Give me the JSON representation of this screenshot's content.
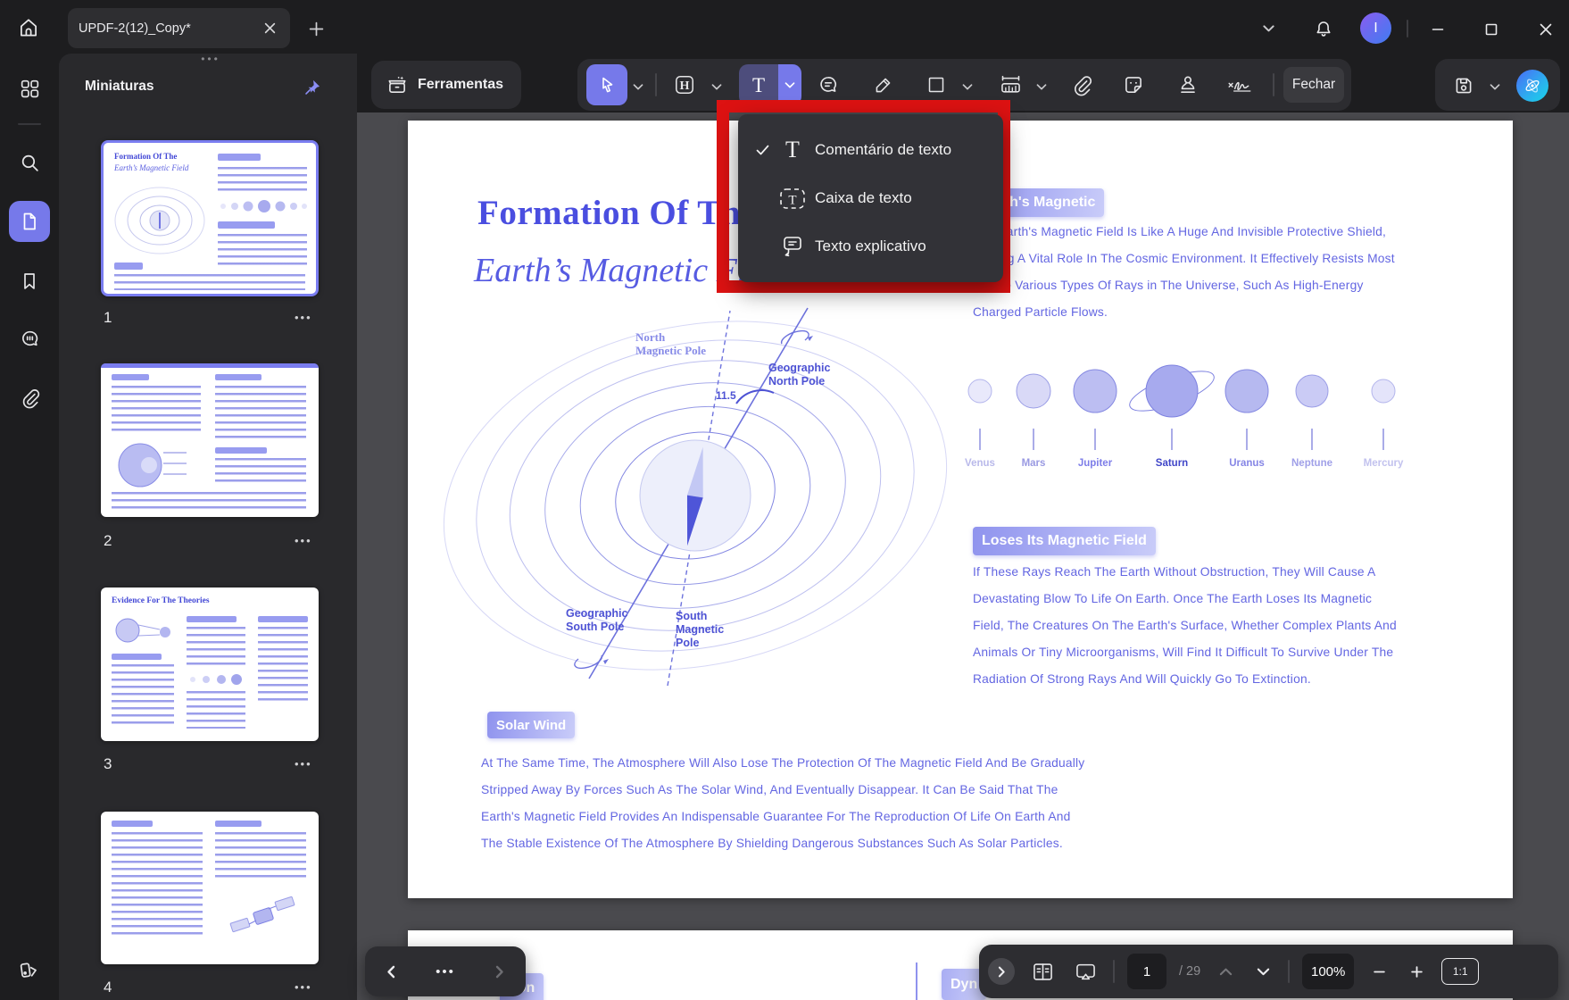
{
  "window": {
    "tab_title": "UPDF-2(12)_Copy*",
    "avatar_initial": "I"
  },
  "sidebar_panel": {
    "title": "Miniaturas",
    "thumbnails": [
      {
        "page": "1"
      },
      {
        "page": "2"
      },
      {
        "page": "3"
      },
      {
        "page": "4"
      }
    ]
  },
  "toolbar": {
    "tools_label": "Ferramentas",
    "close_label": "Fechar"
  },
  "dropdown": {
    "items": [
      {
        "label": "Comentário de texto",
        "icon": "text-comment-icon",
        "checked": true
      },
      {
        "label": "Caixa de texto",
        "icon": "text-box-icon",
        "checked": false
      },
      {
        "label": "Texto explicativo",
        "icon": "callout-icon",
        "checked": false
      }
    ]
  },
  "document": {
    "title_line1": "Formation Of The",
    "title_line2": "Earth’s Magnetic Field",
    "section1_badge": "Earth's Magnetic",
    "section1_lines": [
      "The Earth's Magnetic Field Is Like A Huge And Invisible Protective Shield,",
      "Playing A Vital Role In The Cosmic Environment. It Effectively Resists Most",
      "Of The Various Types Of Rays in The Universe, Such As High-Energy",
      "Charged Particle Flows."
    ],
    "planets": [
      "Venus",
      "Mars",
      "Jupiter",
      "Saturn",
      "Uranus",
      "Neptune",
      "Mercury"
    ],
    "diagram_labels": {
      "north_magnetic": "North\nMagnetic Pole",
      "geo_north": "Geographic\nNorth Pole",
      "angle": "11.5",
      "geo_south": "Geographic\nSouth Pole",
      "south_magnetic": "South\nMagnetic\nPole"
    },
    "section2_badge": "Loses Its Magnetic Field",
    "section2_lines": [
      "If These Rays Reach The Earth Without Obstruction, They Will Cause A",
      "Devastating Blow To Life On Earth. Once The Earth Loses Its Magnetic",
      "Field, The Creatures On The Earth's Surface, Whether Complex Plants And",
      "Animals Or Tiny Microorganisms, Will Find It Difficult To Survive Under The",
      "Radiation Of Strong Rays And Will Quickly Go To Extinction."
    ],
    "section3_badge": "Solar Wind",
    "section3_lines": [
      "At The Same Time, The Atmosphere Will Also Lose The Protection Of The Magnetic Field And Be Gradually",
      "Stripped Away By Forces Such As The Solar Wind, And Eventually Disappear. It Can Be Said That The",
      "Earth's Magnetic Field Provides An Indispensable Guarantee For The Reproduction Of Life On Earth And",
      "The Stable Existence Of The Atmosphere By Shielding Dangerous Substances Such As Solar Particles."
    ],
    "next_page_badge_left": "tion",
    "next_page_badge_right": "Dyn",
    "thumb1_title1": "Formation Of The",
    "thumb1_title2": "Earth’s Magnetic Field",
    "thumb3_title": "Evidence For The Theories"
  },
  "statusbar": {
    "page_current": "1",
    "page_total": "/ 29",
    "zoom": "100%",
    "ratio": "1:1"
  }
}
